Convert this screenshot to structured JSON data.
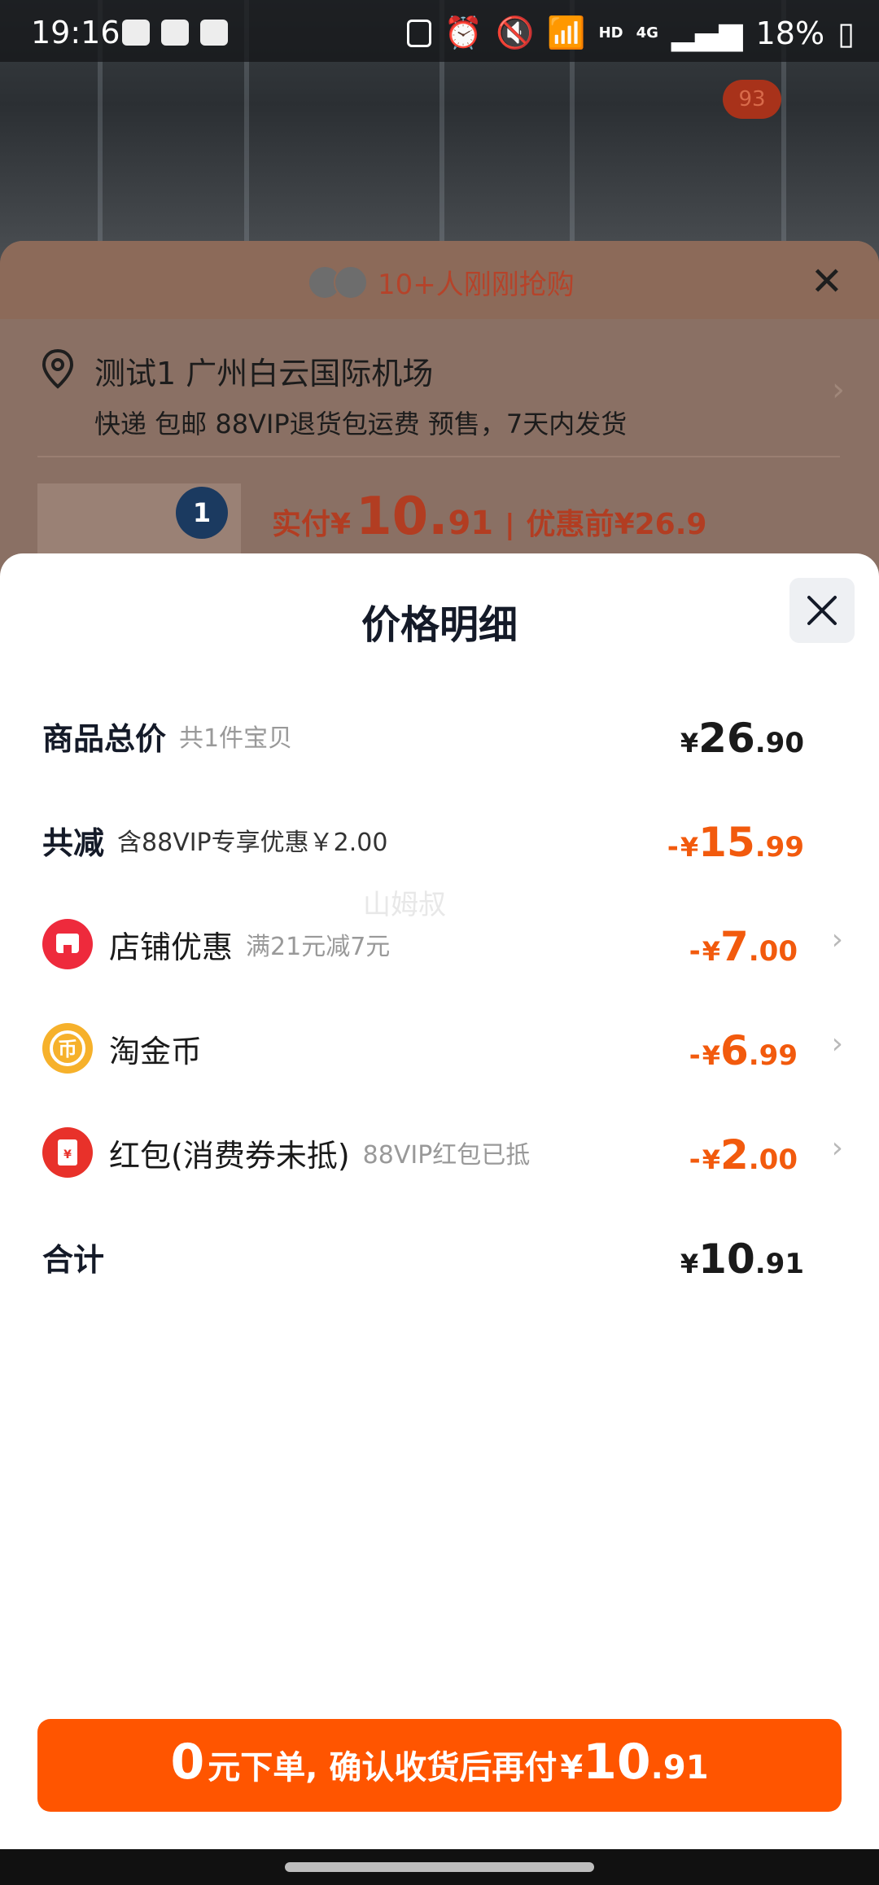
{
  "status_bar": {
    "time": "19:16",
    "battery": "18%",
    "network": "4G",
    "hd_label": "HD",
    "left_icons": [
      "wechat-icon",
      "gallery-icon",
      "check-icon"
    ],
    "right_icons": [
      "sim-icon",
      "alarm-icon",
      "mute-icon",
      "wifi-icon",
      "signal-icon",
      "battery-icon"
    ]
  },
  "background": {
    "badge_count": "93",
    "recent_buyers": "10+人刚刚抢购",
    "address_title": "测试1 广州白云国际机场",
    "address_sub": "快递 包邮 88VIP退货包运费 预售，7天内发货",
    "product_quantity": "1",
    "paid_label": "实付",
    "paid_currency": "¥",
    "paid_int": "10.",
    "paid_dec": "91",
    "pre_discount_label": "优惠前",
    "pre_discount_value": "¥26.9"
  },
  "modal": {
    "title": "价格明细",
    "watermark": "山姆叔",
    "rows": {
      "total": {
        "label": "商品总价",
        "sub": "共1件宝贝",
        "currency": "¥",
        "int": "26",
        "dec": ".90"
      },
      "reduced": {
        "label": "共减",
        "sub": "含88VIP专享优惠￥2.00",
        "sign": "-",
        "currency": "¥",
        "int": "15",
        "dec": ".99"
      },
      "shop": {
        "label": "店铺优惠",
        "sub": "满21元减7元",
        "sign": "-",
        "currency": "¥",
        "int": "7",
        "dec": ".00"
      },
      "coin": {
        "label": "淘金币",
        "sign": "-",
        "currency": "¥",
        "int": "6",
        "dec": ".99"
      },
      "redpacket": {
        "label": "红包(消费券未抵)",
        "sub": "88VIP红包已抵",
        "sign": "-",
        "currency": "¥",
        "int": "2",
        "dec": ".00"
      },
      "sum": {
        "label": "合计",
        "currency": "¥",
        "int": "10",
        "dec": ".91"
      }
    },
    "confirm": {
      "zero": "0",
      "text": "元下单, 确认收货后再付",
      "currency": "¥",
      "int": "10",
      "dec": ".91"
    }
  },
  "colors": {
    "accent": "#ff5500",
    "amount_orange": "#f25a0d",
    "shop_red": "#ee2a3c",
    "coin_gold": "#f6b12b",
    "redpacket_red": "#e8312a"
  }
}
